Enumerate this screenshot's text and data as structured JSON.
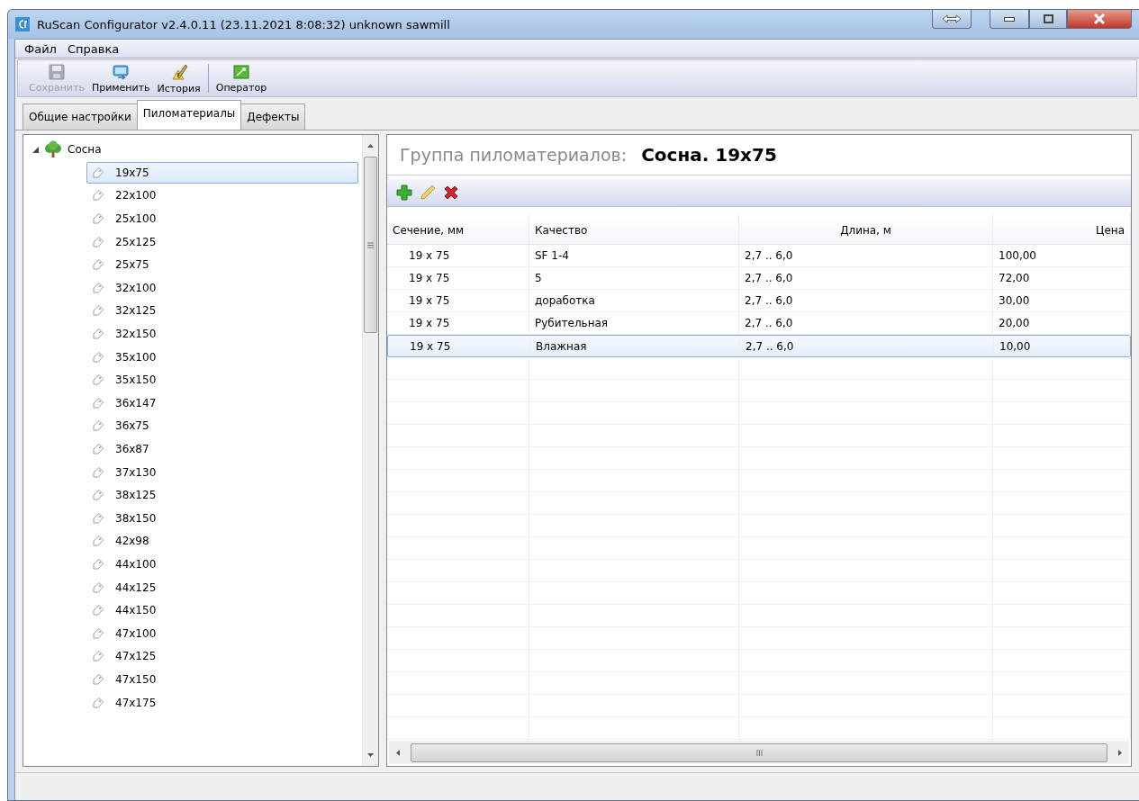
{
  "window": {
    "title": "RuScan Configurator v2.4.0.11 (23.11.2021 8:08:32) unknown sawmill"
  },
  "menu": [
    {
      "label": "Файл"
    },
    {
      "label": "Справка"
    }
  ],
  "toolbar": [
    [
      {
        "label": "Сохранить",
        "kind": "save",
        "disabled": true
      },
      {
        "label": "Применить",
        "kind": "apply",
        "disabled": false
      },
      {
        "label": "История",
        "kind": "history",
        "disabled": false
      }
    ],
    [
      {
        "label": "Оператор",
        "kind": "operator",
        "disabled": false
      }
    ]
  ],
  "tabs": [
    {
      "label": "Общие настройки",
      "selected": false
    },
    {
      "label": "Пиломатериалы",
      "selected": true
    },
    {
      "label": "Дефекты",
      "selected": false
    }
  ],
  "tree": [
    {
      "label": "Сосна",
      "expanded": true,
      "children": [
        {
          "label": "19x75",
          "selected": true
        },
        {
          "label": "22x100",
          "selected": false
        },
        {
          "label": "25x100",
          "selected": false
        },
        {
          "label": "25x125",
          "selected": false
        },
        {
          "label": "25x75",
          "selected": false
        },
        {
          "label": "32x100",
          "selected": false
        },
        {
          "label": "32x125",
          "selected": false
        },
        {
          "label": "32x150",
          "selected": false
        },
        {
          "label": "35x100",
          "selected": false
        },
        {
          "label": "35x150",
          "selected": false
        },
        {
          "label": "36x147",
          "selected": false
        },
        {
          "label": "36x75",
          "selected": false
        },
        {
          "label": "36x87",
          "selected": false
        },
        {
          "label": "37x130",
          "selected": false
        },
        {
          "label": "38x125",
          "selected": false
        },
        {
          "label": "38x150",
          "selected": false
        },
        {
          "label": "42x98",
          "selected": false
        },
        {
          "label": "44x100",
          "selected": false
        },
        {
          "label": "44x125",
          "selected": false
        },
        {
          "label": "44x150",
          "selected": false
        },
        {
          "label": "47x100",
          "selected": false
        },
        {
          "label": "47x125",
          "selected": false
        },
        {
          "label": "47x150",
          "selected": false
        },
        {
          "label": "47x175",
          "selected": false
        }
      ]
    }
  ],
  "group": {
    "label": "Группа пиломатериалов:",
    "value": "Сосна. 19x75"
  },
  "edit_toolbar": [
    {
      "kind": "add"
    },
    {
      "kind": "edit"
    },
    {
      "kind": "delete"
    }
  ],
  "table": {
    "columns": [
      {
        "label": "Сечение, мм"
      },
      {
        "label": "Качество"
      },
      {
        "label": "Длина, м"
      },
      {
        "label": "Цена"
      }
    ],
    "rows": [
      {
        "cells": [
          "19 x 75",
          "SF 1-4",
          "2,7 .. 6,0",
          "100,00"
        ],
        "selected": false
      },
      {
        "cells": [
          "19 x 75",
          "5",
          "2,7 .. 6,0",
          "72,00"
        ],
        "selected": false
      },
      {
        "cells": [
          "19 x 75",
          "доработка",
          "2,7 .. 6,0",
          "30,00"
        ],
        "selected": false
      },
      {
        "cells": [
          "19 x 75",
          "Рубительная",
          "2,7 .. 6,0",
          "20,00"
        ],
        "selected": false
      },
      {
        "cells": [
          "19 x 75",
          "Влажная",
          "2,7 .. 6,0",
          "10,00"
        ],
        "selected": true
      }
    ]
  }
}
